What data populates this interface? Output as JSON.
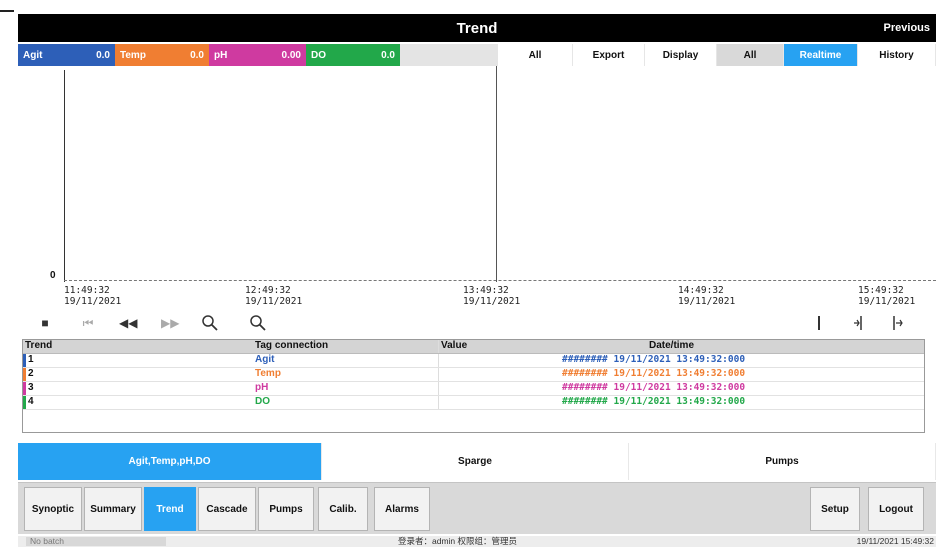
{
  "window": {
    "title": "Trend",
    "previous_label": "Previous"
  },
  "legend": [
    {
      "label": "Agit",
      "value": "0.0",
      "color": "#2d5fb8"
    },
    {
      "label": "Temp",
      "value": "0.0",
      "color": "#f07e32"
    },
    {
      "label": "pH",
      "value": "0.00",
      "color": "#cf3aa0"
    },
    {
      "label": "DO",
      "value": "0.0",
      "color": "#22a84a"
    }
  ],
  "toolbar": {
    "all1": "All",
    "export": "Export",
    "display": "Display",
    "all2": "All",
    "realtime": "Realtime",
    "history": "History"
  },
  "plot": {
    "y_zero_label": "0",
    "x_ticks": [
      {
        "time": "11:49:32",
        "date": "19/11/2021"
      },
      {
        "time": "12:49:32",
        "date": "19/11/2021"
      },
      {
        "time": "13:49:32",
        "date": "19/11/2021"
      },
      {
        "time": "14:49:32",
        "date": "19/11/2021"
      },
      {
        "time": "15:49:32",
        "date": "19/11/2021"
      }
    ]
  },
  "table": {
    "headers": {
      "trend": "Trend",
      "tag": "Tag connection",
      "value": "Value",
      "datetime": "Date/time"
    },
    "rows": [
      {
        "trend": "1",
        "tag": "Agit",
        "value": "########",
        "datetime": "19/11/2021 13:49:32:000",
        "color": "#2d5fb8"
      },
      {
        "trend": "2",
        "tag": "Temp",
        "value": "########",
        "datetime": "19/11/2021 13:49:32:000",
        "color": "#f07e32"
      },
      {
        "trend": "3",
        "tag": "pH",
        "value": "########",
        "datetime": "19/11/2021 13:49:32:000",
        "color": "#cf3aa0"
      },
      {
        "trend": "4",
        "tag": "DO",
        "value": "########",
        "datetime": "19/11/2021 13:49:32:000",
        "color": "#22a84a"
      }
    ]
  },
  "group_tabs": {
    "tab1": "Agit,Temp,pH,DO",
    "tab2": "Sparge",
    "tab3": "Pumps"
  },
  "nav": {
    "synoptic": "Synoptic",
    "summary": "Summary",
    "trend": "Trend",
    "cascade": "Cascade",
    "pumps": "Pumps",
    "calib": "Calib.",
    "alarms": "Alarms",
    "setup": "Setup",
    "logout": "Logout"
  },
  "status": {
    "field": "No batch",
    "user": "登录者：admin  权限组：管理员",
    "datetime": "19/11/2021 15:49:32"
  },
  "colors": {
    "accent": "#27a2f2",
    "titlebar": "#000000"
  }
}
